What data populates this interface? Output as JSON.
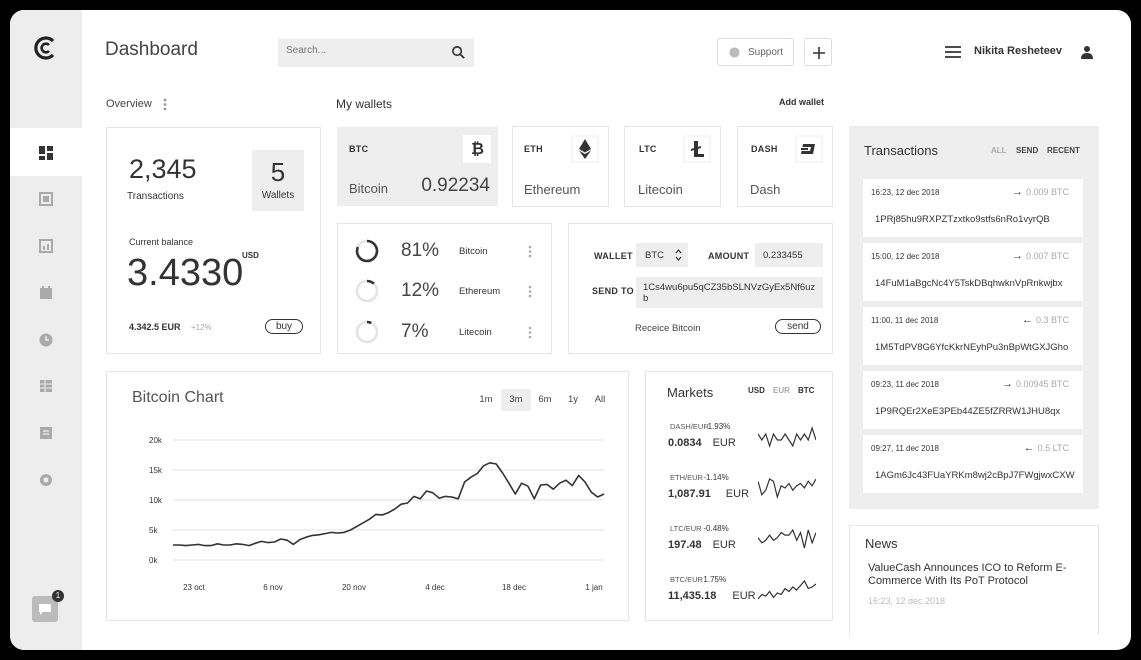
{
  "header": {
    "title": "Dashboard",
    "search_placeholder": "Search...",
    "support_label": "Support",
    "user_name": "Nikita Resheteev"
  },
  "overview": {
    "label": "Overview",
    "transactions_value": "2,345",
    "transactions_label": "Transactions",
    "wallets_value": "5",
    "wallets_label": "Wallets",
    "balance_label": "Current balance",
    "balance_value": "3.4330",
    "balance_unit": "USD",
    "eur_value": "4.342.5 EUR",
    "eur_change": "+12%",
    "buy_label": "buy"
  },
  "wallets": {
    "label": "My wallets",
    "add_label": "Add wallet",
    "items": [
      {
        "code": "BTC",
        "name": "Bitcoin",
        "value": "0.92234"
      },
      {
        "code": "ETH",
        "name": "Ethereum",
        "value": ""
      },
      {
        "code": "LTC",
        "name": "Litecoin",
        "value": ""
      },
      {
        "code": "DASH",
        "name": "Dash",
        "value": ""
      }
    ]
  },
  "allocation": [
    {
      "percent": "81%",
      "name": "Bitcoin",
      "fraction": 0.81
    },
    {
      "percent": "12%",
      "name": "Ethereum",
      "fraction": 0.12
    },
    {
      "percent": "7%",
      "name": "Litecoin",
      "fraction": 0.07
    }
  ],
  "send_form": {
    "wallet_label": "WALLET",
    "wallet_value": "BTC",
    "amount_label": "AMOUNT",
    "amount_value": "0.233455",
    "send_to_label": "SEND TO",
    "send_to_value": "1Cs4wu6pu5qCZ35bSLNVzGyEx5Nf6uzb",
    "receive_label": "Receice Bitcoin",
    "send_label": "send"
  },
  "chart_data": {
    "type": "line",
    "title": "Bitcoin Chart",
    "ranges": [
      "1m",
      "3m",
      "6m",
      "1y",
      "All"
    ],
    "active_range": "3m",
    "y_ticks": [
      "20k",
      "15k",
      "10k",
      "5k",
      "0k"
    ],
    "x_ticks": [
      "23 oct",
      "6 nov",
      "20 nov",
      "4 dec",
      "18 dec",
      "1 jan"
    ],
    "ylim": [
      0,
      20000
    ],
    "values": [
      2500,
      2500,
      2400,
      2500,
      2600,
      2400,
      2400,
      2700,
      2500,
      2500,
      2700,
      2600,
      2400,
      2800,
      3100,
      2900,
      3000,
      3500,
      3300,
      2600,
      3400,
      3800,
      4100,
      4200,
      4400,
      4600,
      4500,
      4600,
      5000,
      5600,
      6200,
      6800,
      7600,
      7500,
      7900,
      8500,
      9300,
      9500,
      10600,
      10200,
      11500,
      11200,
      10300,
      10600,
      10500,
      10200,
      13000,
      13800,
      14400,
      15700,
      16200,
      16000,
      14500,
      12800,
      11000,
      12800,
      12300,
      10200,
      12500,
      12600,
      11800,
      12800,
      13300,
      12400,
      14100,
      13000,
      11300,
      10500,
      11000
    ]
  },
  "markets": {
    "title": "Markets",
    "currencies": [
      "USD",
      "EUR",
      "BTC"
    ],
    "items": [
      {
        "pair": "DASH/EUR",
        "change": "1.93%",
        "price": "0.0834",
        "unit": "EUR"
      },
      {
        "pair": "ETH/EUR",
        "change": "-1.14%",
        "price": "1,087.91",
        "unit": "EUR"
      },
      {
        "pair": "LTC/EUR",
        "change": "-0.48%",
        "price": "197.48",
        "unit": "EUR"
      },
      {
        "pair": "BTC/EUR",
        "change": "1.75%",
        "price": "11,435.18",
        "unit": "EUR"
      }
    ]
  },
  "transactions": {
    "title": "Transactions",
    "filters": [
      "ALL",
      "SEND",
      "RECENT"
    ],
    "items": [
      {
        "time": "16:23, 12 dec 2018",
        "amount": "0.009 BTC",
        "direction": "out",
        "address": "1PRj85hu9RXPZTzxtko9stfs6nRo1vyrQB"
      },
      {
        "time": "15:00, 12 dec 2018",
        "amount": "0.007 BTC",
        "direction": "out",
        "address": "14FuM1aBgcNc4Y5TskDBqhwknVpRnkwjbx"
      },
      {
        "time": "11:00, 11 dec 2018",
        "amount": "0.3 BTC",
        "direction": "in",
        "address": "1M5TdPV8G6YfcKkrNEyhPu3nBpWtGXJGho"
      },
      {
        "time": "09:23, 11 dec 2018",
        "amount": "0.00945 BTC",
        "direction": "out",
        "address": "1P9RQEr2XeE3PEb44ZE5fZRRW1JHU8qx"
      },
      {
        "time": "09:27, 11 dec 2018",
        "amount": "0.5 LTC",
        "direction": "in",
        "address": "1AGm6Jc43FUaYRKm8wj2cBpJ7FWgjwxCXW"
      }
    ]
  },
  "news": {
    "title": "News",
    "headline": "ValueCash Announces ICO to Reform E-Commerce With Its PoT Protocol",
    "date": "16:23, 12 dec 2018"
  },
  "sidebar": {
    "icons": [
      "dashboard-icon",
      "wallet-icon",
      "stats-icon",
      "calendar-icon",
      "clock-icon",
      "table-icon",
      "document-icon",
      "gear-icon"
    ],
    "chat_badge": "1"
  }
}
